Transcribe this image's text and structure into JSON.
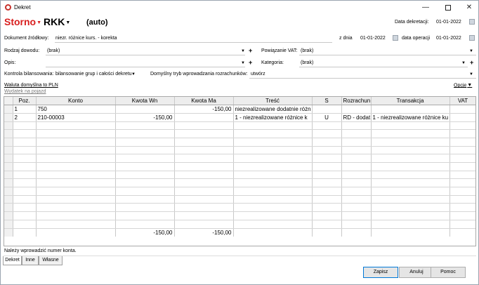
{
  "window": {
    "title": "Dekret"
  },
  "header": {
    "storno": "Storno",
    "rkk": "RKK",
    "auto": "(auto)",
    "data_dekretacji_label": "Data dekretacji:",
    "data_dekretacji": "01-01-2022"
  },
  "form": {
    "dokument_label": "Dokument źródłowy:",
    "dokument_value": "niezr. różnice kurs. - korekta",
    "z_dnia_label": "z dnia",
    "z_dnia": "01-01-2022",
    "data_operacji_label": "data operacji",
    "data_operacji": "01-01-2022",
    "rodzaj_label": "Rodzaj dowodu:",
    "rodzaj_value": "(brak)",
    "powiazanie_label": "Powiązanie VAT:",
    "powiazanie_value": "(brak)",
    "opis_label": "Opis:",
    "opis_value": "",
    "kategoria_label": "Kategoria:",
    "kategoria_value": "(brak)",
    "kontrola_label": "Kontrola bilansowania:",
    "kontrola_value": "bilansowanie grup i całości dekretu",
    "tryb_label": "Domyślny tryb wprowadzania rozrachunków:",
    "tryb_value": "utwórz",
    "waluta_link": "Waluta domyślna to PLN",
    "wydatek_link": "Wydatek na pojazd",
    "opcje": "Opcje"
  },
  "grid": {
    "columns": [
      "Poz.",
      "Konto",
      "Kwota Wn",
      "Kwota Ma",
      "Treść",
      "S",
      "Rozrachun",
      "Transakcja",
      "VAT"
    ],
    "rows": [
      {
        "poz": "1",
        "konto": "750",
        "wn": "",
        "ma": "-150,00",
        "tresc": "niezrealizowane dodatnie różn",
        "s": "",
        "rozrachunek": "",
        "transakcja": "",
        "vat": ""
      },
      {
        "poz": "2",
        "konto": "210-00003",
        "wn": "-150,00",
        "ma": "",
        "tresc": "1 - niezrealizowane różnice k",
        "s": "U",
        "rozrachunek": "RD - dodat",
        "transakcja": "1 - niezrealizowane różnice ku",
        "vat": ""
      }
    ],
    "totals": {
      "wn": "-150,00",
      "ma": "-150,00"
    }
  },
  "status": "Należy wprowadzić numer konta.",
  "tabs": [
    "Dekret",
    "Inne",
    "Własne"
  ],
  "buttons": {
    "save": "Zapisz",
    "cancel": "Anuluj",
    "help": "Pomoc"
  }
}
